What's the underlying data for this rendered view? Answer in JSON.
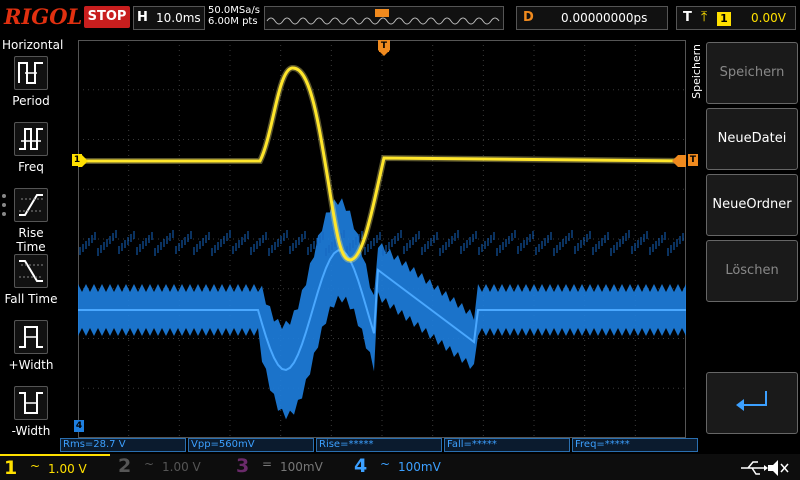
{
  "brand": "RIGOL",
  "run_state": "STOP",
  "timebase": {
    "letter": "H",
    "value": "10.0ms"
  },
  "acquisition": {
    "sample_rate": "50.0MSa/s",
    "memory_depth": "6.00M pts"
  },
  "delay": {
    "letter": "D",
    "value": "0.00000000ps"
  },
  "trigger": {
    "letter": "T",
    "channel": "1",
    "level": "0.00V"
  },
  "left_menu": {
    "title": "Horizontal",
    "items": [
      {
        "label": "Period",
        "icon": "period-icon"
      },
      {
        "label": "Freq",
        "icon": "freq-icon"
      },
      {
        "label": "Rise Time",
        "icon": "rise-time-icon"
      },
      {
        "label": "Fall Time",
        "icon": "fall-time-icon"
      },
      {
        "label": "+Width",
        "icon": "positive-width-icon"
      },
      {
        "label": "-Width",
        "icon": "negative-width-icon"
      }
    ]
  },
  "markers": {
    "ch1": "1",
    "trigger": "T",
    "ch4": "4"
  },
  "right_menu": {
    "title": "Speichern",
    "buttons": [
      {
        "label": "Speichern",
        "enabled": false
      },
      {
        "label": "NeueDatei",
        "enabled": true
      },
      {
        "label": "NeueOrdner",
        "enabled": true
      },
      {
        "label": "Löschen",
        "enabled": false
      }
    ],
    "back_icon": "return-arrow-icon"
  },
  "measurements": [
    {
      "label": "Rms=28.7 V"
    },
    {
      "label": "Vpp=560mV"
    },
    {
      "label": "Rise=*****"
    },
    {
      "label": "Fall=*****"
    },
    {
      "label": "Freq=*****"
    }
  ],
  "channels": [
    {
      "num": "1",
      "coupling": "~",
      "scale": "1.00 V",
      "color": "#ffe000",
      "active": true
    },
    {
      "num": "2",
      "coupling": "~",
      "scale": "1.00 V",
      "color": "#555555",
      "active": false
    },
    {
      "num": "3",
      "coupling": "=",
      "scale": "100mV",
      "color": "#6a2a6a",
      "active": false
    },
    {
      "num": "4",
      "coupling": "~",
      "scale": "100mV",
      "color": "#3ca0ff",
      "active": true
    }
  ],
  "status_icons": [
    "usb-icon",
    "speaker-muted-icon"
  ],
  "colors": {
    "ch1": "#ffe000",
    "ch4": "#1e90ff",
    "trigger": "#f08a1e",
    "stop": "#c81e1e"
  }
}
